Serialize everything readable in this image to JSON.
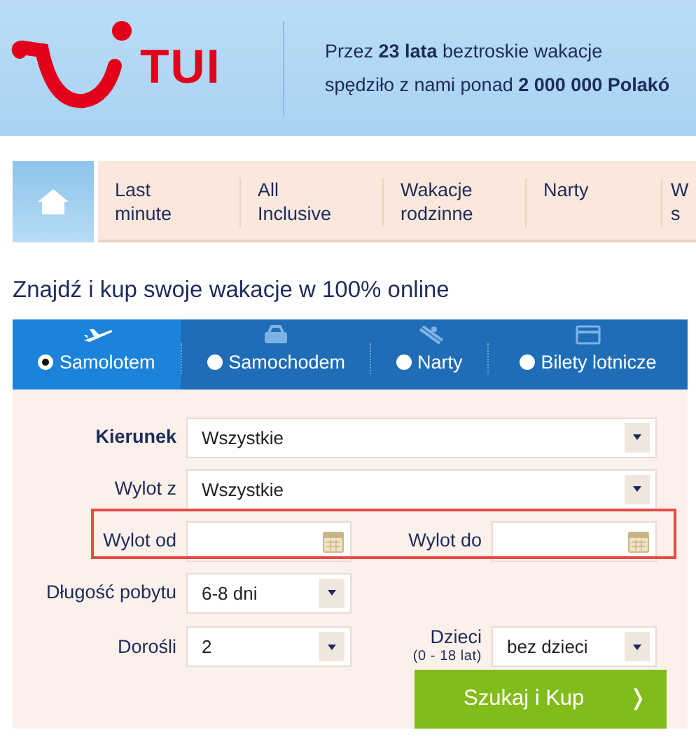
{
  "header": {
    "logo_text": "TUI",
    "tagline": [
      {
        "text": "Przez **23 lata** beztroskie wakacje"
      },
      {
        "text": "spędziło z nami ponad **2 000 000 Polakó**"
      }
    ]
  },
  "nav": [
    {
      "kind": "home",
      "selected": true
    },
    {
      "kind": "link",
      "lines": [
        "Last",
        "minute"
      ],
      "selected": false
    },
    {
      "kind": "link",
      "lines": [
        "All",
        "Inclusive"
      ],
      "selected": false
    },
    {
      "kind": "link",
      "lines": [
        "Wakacje",
        "rodzinne"
      ],
      "selected": false
    },
    {
      "kind": "link",
      "lines": [
        "Narty"
      ],
      "selected": false
    },
    {
      "kind": "link",
      "lines": [
        "W",
        "s"
      ],
      "selected": false
    }
  ],
  "heading": "Znajdź i kup swoje wakacje w 100% online",
  "transport_tabs": [
    {
      "label": "Samolotem",
      "selected": true
    },
    {
      "label": "Samochodem",
      "selected": false
    },
    {
      "label": "Narty",
      "selected": false
    },
    {
      "label": "Bilety lotnicze",
      "selected": false
    }
  ],
  "form": {
    "kierunek": {
      "label": "Kierunek",
      "value": "Wszystkie"
    },
    "wylot_z": {
      "label": "Wylot z",
      "value": "Wszystkie"
    },
    "wylot_od": {
      "label": "Wylot od"
    },
    "wylot_do": {
      "label": "Wylot do"
    },
    "dlugosc": {
      "label": "Długość pobytu",
      "value": "6-8 dni"
    },
    "dorosli": {
      "label": "Dorośli",
      "value": "2"
    },
    "dzieci": {
      "label": "Dzieci",
      "sublabel": "(0 - 18 lat)",
      "value": "bez dzieci"
    },
    "submit": {
      "label": "Szukaj i Kup",
      "arrow": "❭"
    }
  }
}
